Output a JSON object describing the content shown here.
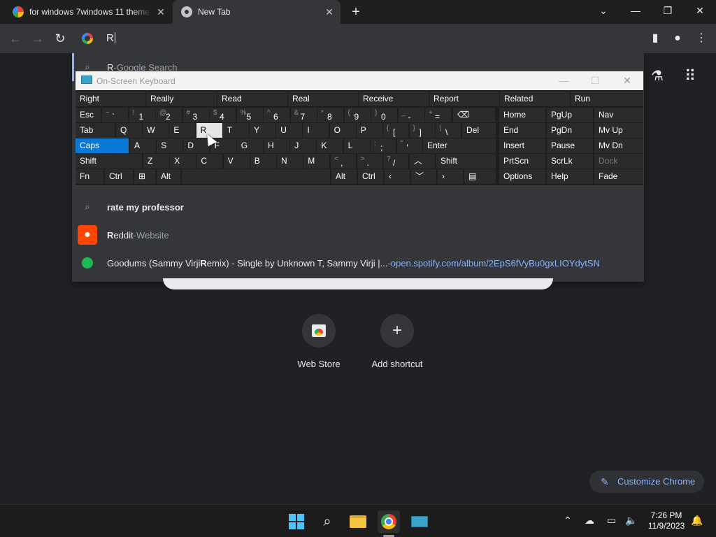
{
  "tabs": [
    {
      "title": "for windows 7windows 11 theme",
      "active": false
    },
    {
      "title": "New Tab",
      "active": true
    }
  ],
  "omnibox": {
    "value": "R"
  },
  "suggestions": {
    "first": {
      "query": "R",
      "sep": " - ",
      "hint": "Google Search"
    },
    "search": {
      "text": "rate my professor"
    },
    "reddit": {
      "match": "R",
      "rest": "eddit",
      "sep": " - ",
      "type": "Website"
    },
    "spotify": {
      "pre": "Goodums (Sammy Virji ",
      "match": "R",
      "post": "emix) - Single by Unknown T, Sammy Virji |...",
      "sep": " - ",
      "url": "open.spotify.com/album/2EpS6fVyBu0gxLIOYdytSN"
    }
  },
  "keyboard": {
    "title": "On-Screen Keyboard",
    "predictions": [
      "Right",
      "Really",
      "Read",
      "Real",
      "Receive",
      "Report",
      "Related",
      "Run"
    ],
    "row1": {
      "esc": "Esc",
      "del": "Del"
    },
    "row2": {
      "tab": "Tab",
      "letters": [
        "Q",
        "W",
        "E",
        "R",
        "T",
        "Y",
        "U",
        "I",
        "O",
        "P"
      ],
      "del": "Del"
    },
    "row3": {
      "caps": "Caps",
      "letters": [
        "A",
        "S",
        "D",
        "F",
        "G",
        "H",
        "J",
        "K",
        "L"
      ],
      "enter": "Enter"
    },
    "row4": {
      "shift": "Shift",
      "letters": [
        "Z",
        "X",
        "C",
        "V",
        "B",
        "N",
        "M"
      ],
      "shift2": "Shift"
    },
    "row5": {
      "fn": "Fn",
      "ctrl": "Ctrl",
      "alt": "Alt",
      "alt2": "Alt",
      "ctrl2": "Ctrl"
    },
    "nav": {
      "home": "Home",
      "pgup": "PgUp",
      "nav": "Nav",
      "end": "End",
      "pgdn": "PgDn",
      "mvup": "Mv Up",
      "insert": "Insert",
      "pause": "Pause",
      "mvdn": "Mv Dn",
      "prtscn": "PrtScn",
      "scrlk": "ScrLk",
      "dock": "Dock",
      "options": "Options",
      "help": "Help",
      "fade": "Fade"
    },
    "symbols": [
      {
        "s": "~",
        "c": "`"
      },
      {
        "s": "!",
        "c": "1"
      },
      {
        "s": "@",
        "c": "2"
      },
      {
        "s": "#",
        "c": "3"
      },
      {
        "s": "$",
        "c": "4"
      },
      {
        "s": "%",
        "c": "5"
      },
      {
        "s": "^",
        "c": "6"
      },
      {
        "s": "&",
        "c": "7"
      },
      {
        "s": "*",
        "c": "8"
      },
      {
        "s": "(",
        "c": "9"
      },
      {
        "s": ")",
        "c": "0"
      },
      {
        "s": "_",
        "c": "-"
      },
      {
        "s": "+",
        "c": "="
      }
    ],
    "row2sym": [
      {
        "s": "{",
        "c": "["
      },
      {
        "s": "}",
        "c": "]"
      },
      {
        "s": "|",
        "c": "\\"
      }
    ],
    "row3sym": [
      {
        "s": ":",
        "c": ";"
      },
      {
        "s": "\"",
        "c": "'"
      }
    ],
    "row4sym": [
      {
        "s": "<",
        "c": ","
      },
      {
        "s": ">",
        "c": "."
      },
      {
        "s": "?",
        "c": "/"
      }
    ]
  },
  "shortcuts": [
    {
      "label": "Web Store",
      "icon": "webstore-icon"
    },
    {
      "label": "Add shortcut",
      "icon": "plus-icon"
    }
  ],
  "customize": {
    "label": "Customize Chrome"
  },
  "taskbar": {
    "time": "7:26 PM",
    "date": "11/9/2023"
  },
  "colors": {
    "accent": "#0a78d7",
    "link": "#8ab4f8"
  }
}
